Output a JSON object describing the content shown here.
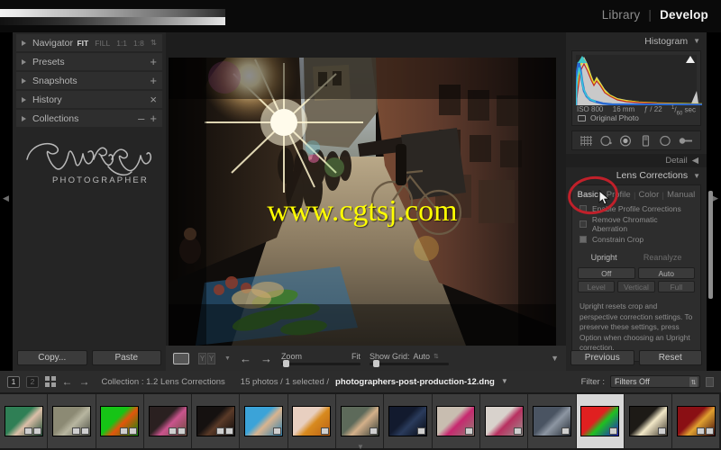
{
  "app": {
    "modules": [
      {
        "label": "Library",
        "active": false
      },
      {
        "label": "Develop",
        "active": true
      }
    ],
    "module_separator": "|"
  },
  "left_panel": {
    "panels": [
      {
        "label": "Navigator",
        "control": "zoom-levels"
      },
      {
        "label": "Presets",
        "control": "plus"
      },
      {
        "label": "Snapshots",
        "control": "plus"
      },
      {
        "label": "History",
        "control": "close"
      },
      {
        "label": "Collections",
        "control": "minus-plus"
      }
    ],
    "navigator_zoom": {
      "fit": "FIT",
      "fill": "FILL",
      "one_to_one": "1:1",
      "ratio": "1:8"
    },
    "identity_plate": {
      "name": "Gavin Gough",
      "subtitle": "PHOTOGRAPHER"
    },
    "buttons": {
      "copy": "Copy...",
      "paste": "Paste"
    }
  },
  "toolbar": {
    "zoom_label": "Zoom",
    "zoom_value": "Fit",
    "show_grid_label": "Show Grid:",
    "show_grid_value": "Auto",
    "prev_arrow": "←",
    "next_arrow": "→"
  },
  "photo": {
    "watermark": "www.cgtsj.com",
    "description": "Sunlit narrow street market in Kathmandu with sunburst, vendors and bicycles"
  },
  "right_panel": {
    "histogram": {
      "title": "Histogram",
      "iso": "ISO 800",
      "focal": "16 mm",
      "aperture": "ƒ / 22",
      "shutter_num": "1",
      "shutter_den": "60",
      "shutter_unit": "sec",
      "original_photo": "Original Photo"
    },
    "tools": [
      {
        "name": "crop-overlay-icon"
      },
      {
        "name": "spot-removal-icon"
      },
      {
        "name": "red-eye-correction-icon"
      },
      {
        "name": "graduated-filter-icon"
      },
      {
        "name": "radial-filter-icon"
      },
      {
        "name": "adjustment-brush-icon"
      }
    ],
    "detail_label": "Detail",
    "lens_corrections": {
      "title": "Lens Corrections",
      "tabs": [
        {
          "label": "Basic",
          "active": true
        },
        {
          "label": "Profile",
          "active": false
        },
        {
          "label": "Color",
          "active": false
        },
        {
          "label": "Manual",
          "active": false
        }
      ],
      "checkboxes": [
        {
          "label": "Enable Profile Corrections",
          "checked": false
        },
        {
          "label": "Remove Chromatic Aberration",
          "checked": false
        },
        {
          "label": "Constrain Crop",
          "checked": true
        }
      ],
      "upright_label": "Upright",
      "reanalyze_label": "Reanalyze",
      "modes_row1": [
        "Off",
        "Auto"
      ],
      "modes_row2": [
        "Level",
        "Vertical",
        "Full"
      ],
      "help_text": "Upright resets crop and perspective correction settings. To preserve these settings, press Option when choosing an Upright correction."
    },
    "buttons": {
      "previous": "Previous",
      "reset": "Reset"
    }
  },
  "annotation": {
    "highlight_color": "#c0202a",
    "target": "Basic tab"
  },
  "filmstrip_bar": {
    "screen_1": "1",
    "screen_2": "2",
    "collection_label": "Collection : 1.2 Lens Corrections",
    "count_label": "15 photos / 1 selected /",
    "filename": "photographers-post-production-12.dng",
    "filter_label": "Filter :",
    "filter_value": "Filters Off"
  },
  "filmstrip": {
    "selected_index": 12,
    "thumbnails": [
      {
        "name": "girl-green-wall",
        "c1": "#2f7f55",
        "c2": "#dcbfa8",
        "c3": "#1b4a32",
        "badges": 2
      },
      {
        "name": "coastal-landscape",
        "c1": "#8c8a74",
        "c2": "#b8b6a0",
        "c3": "#4a4c42",
        "badges": 2
      },
      {
        "name": "monk-green-screen",
        "c1": "#16c416",
        "c2": "#e2560d",
        "c3": "#0d8a0d",
        "badges": 2
      },
      {
        "name": "woman-pink-shawl",
        "c1": "#2a2020",
        "c2": "#c9548d",
        "c3": "#6b4a3a",
        "badges": 2
      },
      {
        "name": "dark-portrait",
        "c1": "#151110",
        "c2": "#5a3a28",
        "c3": "#0a0808",
        "badges": 2
      },
      {
        "name": "child-blue-background",
        "c1": "#3ba3d8",
        "c2": "#d9b48f",
        "c3": "#2c7fae",
        "badges": 1
      },
      {
        "name": "golden-texture",
        "c1": "#e8cfc0",
        "c2": "#d88a1e",
        "c3": "#b85f14",
        "badges": 1
      },
      {
        "name": "girl-bubble",
        "c1": "#5d6a5a",
        "c2": "#d4b08a",
        "c3": "#2f3a33",
        "badges": 1
      },
      {
        "name": "night-sky-silhouette",
        "c1": "#121a2e",
        "c2": "#2a3b5c",
        "c3": "#050810",
        "badges": 1
      },
      {
        "name": "teddy-bear-flowers",
        "c1": "#c8bdb0",
        "c2": "#c7286f",
        "c3": "#8e8275",
        "badges": 1
      },
      {
        "name": "white-bear-rose",
        "c1": "#d8d2cc",
        "c2": "#b83060",
        "c3": "#9a9490",
        "badges": 1
      },
      {
        "name": "statue-dusk",
        "c1": "#4a5462",
        "c2": "#8d96a2",
        "c3": "#232a34",
        "badges": 1
      },
      {
        "name": "colored-balls-grid",
        "c1": "#e02020",
        "c2": "#20c020",
        "c3": "#2020d0",
        "badges": 1
      },
      {
        "name": "kathmandu-street-selected",
        "c1": "#1d1a16",
        "c2": "#f3e9c8",
        "c3": "#3a3228",
        "badges": 1
      },
      {
        "name": "red-interior-figure",
        "c1": "#8a0f14",
        "c2": "#e0a030",
        "c3": "#3a0608",
        "badges": 2
      }
    ]
  }
}
